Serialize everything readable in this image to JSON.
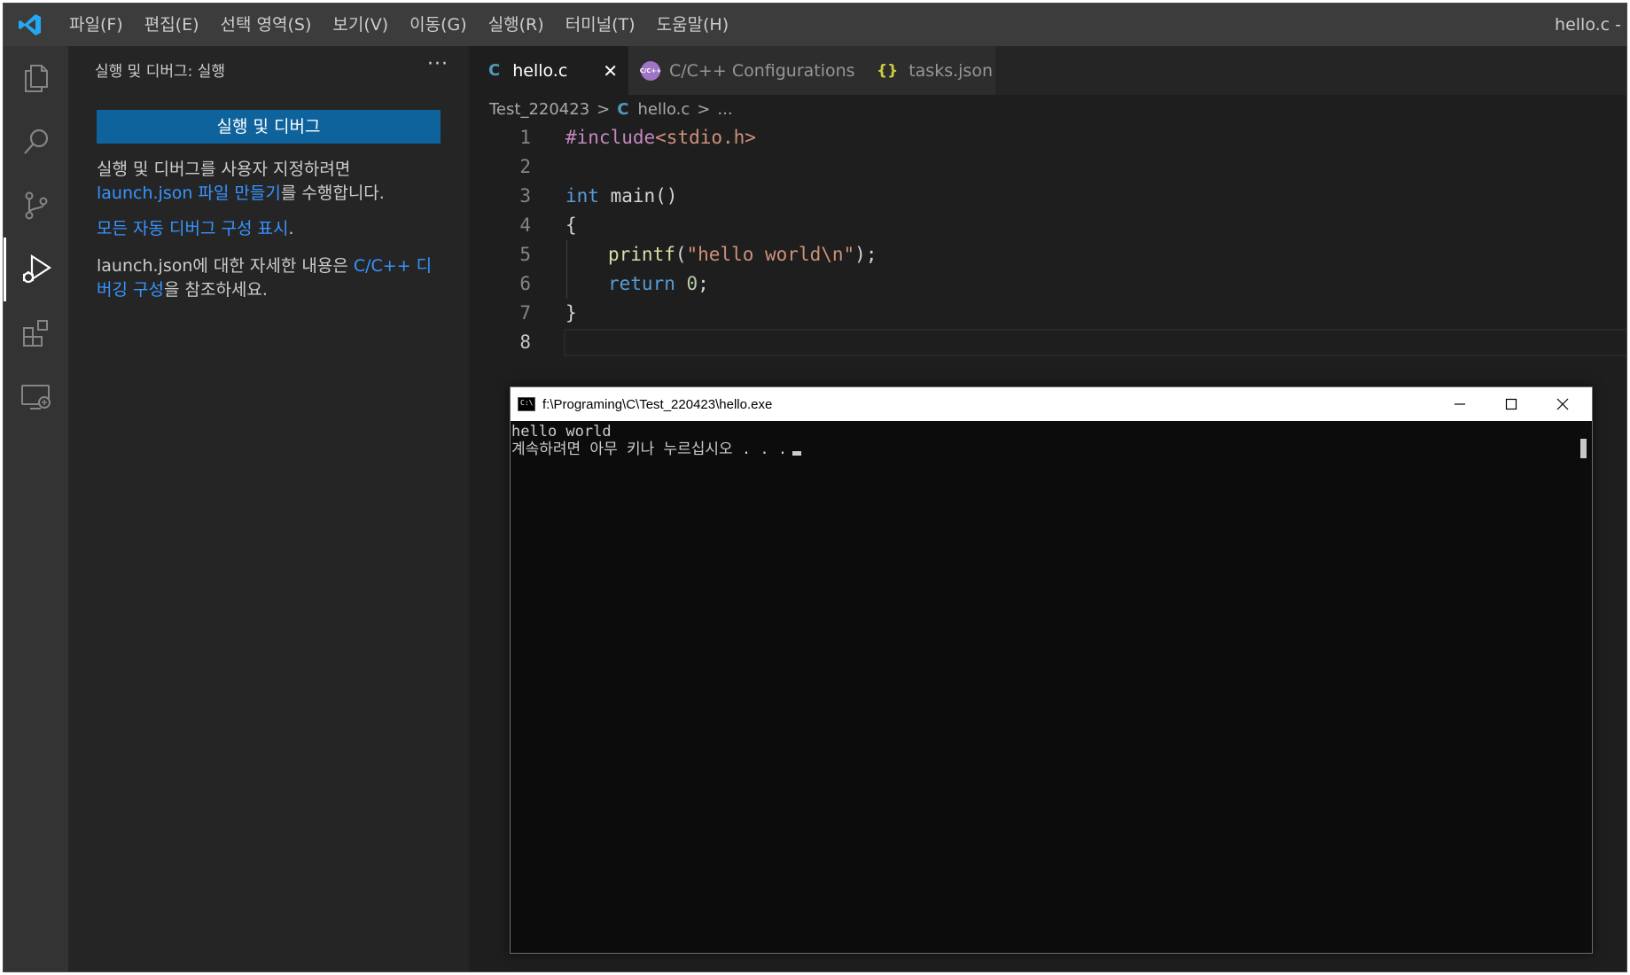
{
  "window_title": "hello.c -",
  "menu": [
    "파일(F)",
    "편집(E)",
    "선택 영역(S)",
    "보기(V)",
    "이동(G)",
    "실행(R)",
    "터미널(T)",
    "도움말(H)"
  ],
  "sidebar": {
    "title": "실행 및 디버그: 실행",
    "more": "···",
    "run_debug_button": "실행 및 디버그",
    "para1_text": "실행 및 디버그를 사용자 지정하려면",
    "para1_link": "launch.json 파일 만들기",
    "para1_tail": "를 수행합니다.",
    "para2_link": "모든 자동 디버그 구성 표시",
    "para2_tail": ".",
    "para3_text": "launch.json에 대한 자세한 내용은 ",
    "para3_link": "C/C++ 디버깅 구성",
    "para3_tail": "을 참조하세요."
  },
  "tabs": [
    {
      "label": "hello.c",
      "icon": "C",
      "active": true,
      "close": "✕"
    },
    {
      "label": "C/C++ Configurations",
      "icon": "C/C++",
      "active": false
    },
    {
      "label": "tasks.json",
      "icon": "{}",
      "active": false
    }
  ],
  "breadcrumb": {
    "folder": "Test_220423",
    "icon": "C",
    "file": "hello.c",
    "more": "..."
  },
  "code": {
    "line_numbers": [
      "1",
      "2",
      "3",
      "4",
      "5",
      "6",
      "7",
      "8"
    ],
    "l1_pre": "#include",
    "l1_str": "<stdio.h>",
    "l3_kw": "int",
    "l3_rest": " main()",
    "l4": "{",
    "l5_fn": "printf",
    "l5_open": "(",
    "l5_str": "\"hello world\\n\"",
    "l5_close": ");",
    "l6_kw": "return",
    "l6_num": "0",
    "l6_end": ";",
    "l7": "}"
  },
  "console": {
    "title": "f:\\Programing\\C\\Test_220423\\hello.exe",
    "line1": "hello world",
    "line2": "계속하려면 아무 키나 누르십시오 . . ."
  },
  "colors": {
    "accent": "#0e639c",
    "link": "#3794ff",
    "vscode_blue": "#23a9f2"
  }
}
